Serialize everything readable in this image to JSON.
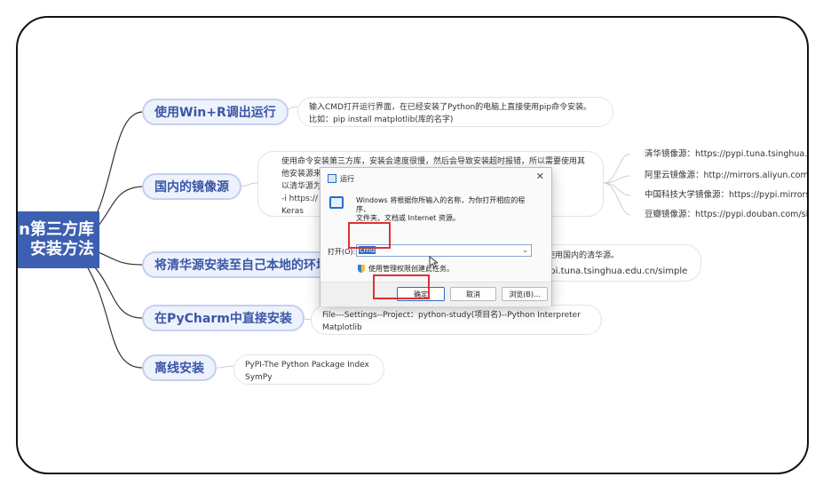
{
  "mindmap": {
    "root": {
      "line1": "n第三方库",
      "line2": "安装方法"
    },
    "topics": [
      {
        "label": "使用Win+R调出运行",
        "notes": [
          "输入CMD打开运行界面，在已经安装了Python的电脑上直接使用pip命令安装。",
          "比如：pip install matplotlib(库的名字)"
        ]
      },
      {
        "label": "国内的镜像源",
        "notes": [
          "使用命令安装第三方库，安装会速度很慢，然后会导致安装超时报错，所以需要使用其",
          "他安装源来",
          "以清华源为",
          "-i https://",
          "Keras"
        ]
      },
      {
        "label": "将清华源安装至自己本地的环境",
        "notes": [
          "以使用国内的清华源。",
          "pypi.tuna.tsinghua.edu.cn/simple"
        ]
      },
      {
        "label": "在PyCharm中直接安装",
        "notes": [
          "File---Settings--Project：python-study(项目名)--Python Interpreter",
          "Matplotlib"
        ]
      },
      {
        "label": "离线安装",
        "notes": [
          "PyPI-The Python Package Index",
          "SymPy"
        ]
      }
    ],
    "mirrors": [
      "清华镜像源：https://pypi.tuna.tsinghua.edu",
      "阿里云镜像源：http://mirrors.aliyun.com/py",
      "中国科技大学镜像源：https://pypi.mirrors.u",
      "豆瓣镜像源：https://pypi.douban.com/simp"
    ]
  },
  "run_dialog": {
    "title": "运行",
    "close": "✕",
    "description_line1": "Windows 将根据你所输入的名称，为你打开相应的程序、",
    "description_line2": "文件夹、文档或 Internet 资源。",
    "open_label": "打开(O):",
    "open_value": "cmd",
    "admin_text": "使用管理权限创建此任务。",
    "buttons": {
      "ok": "确定",
      "cancel": "取消",
      "browse": "浏览(B)..."
    }
  },
  "colors": {
    "topic_text": "#3a56a8",
    "root_bg": "#3c5fb1",
    "highlight": "#e03030"
  }
}
